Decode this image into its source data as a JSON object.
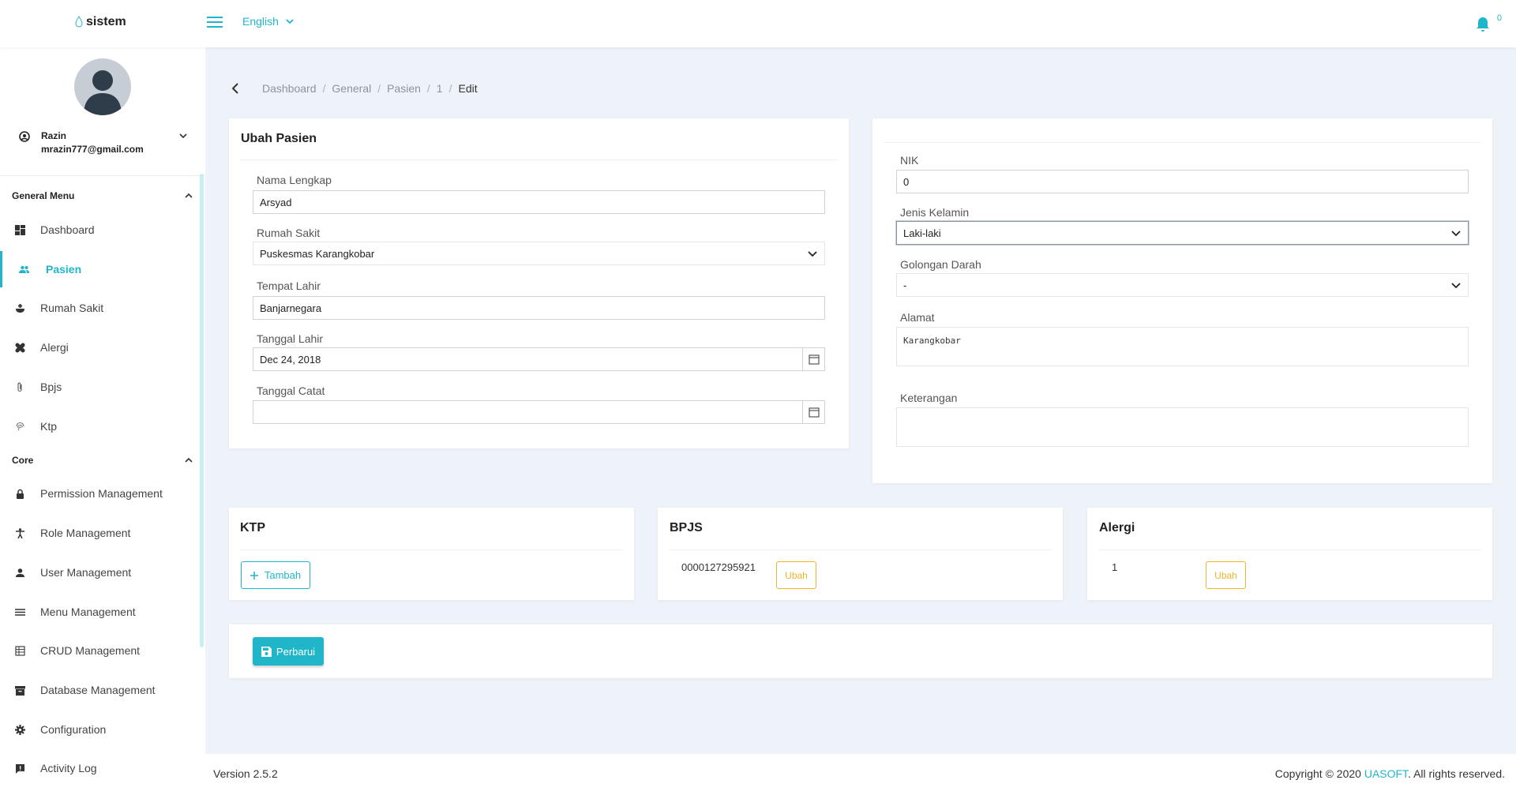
{
  "app": {
    "logo_text": "sistem",
    "language": "English",
    "notification_count": "0"
  },
  "user": {
    "name": "Razin",
    "email": "mrazin777@gmail.com"
  },
  "sidebar": {
    "general_menu": "General Menu",
    "core": "Core",
    "general_items": [
      {
        "label": "Dashboard",
        "icon": "dashboard-icon"
      },
      {
        "label": "Pasien",
        "icon": "users-icon",
        "active": true
      },
      {
        "label": "Rumah Sakit",
        "icon": "hospital-icon"
      },
      {
        "label": "Alergi",
        "icon": "bandage-icon"
      },
      {
        "label": "Bpjs",
        "icon": "paperclip-icon"
      },
      {
        "label": "Ktp",
        "icon": "fingerprint-icon"
      }
    ],
    "core_items": [
      {
        "label": "Permission Management",
        "icon": "lock-icon"
      },
      {
        "label": "Role Management",
        "icon": "person-icon"
      },
      {
        "label": "User Management",
        "icon": "user-icon"
      },
      {
        "label": "Menu Management",
        "icon": "menu-icon"
      },
      {
        "label": "CRUD Management",
        "icon": "table-icon"
      },
      {
        "label": "Database Management",
        "icon": "archive-icon"
      },
      {
        "label": "Configuration",
        "icon": "gear-icon"
      },
      {
        "label": "Activity Log",
        "icon": "feedback-icon"
      }
    ]
  },
  "breadcrumb": [
    "Dashboard",
    "General",
    "Pasien",
    "1",
    "Edit"
  ],
  "form": {
    "title": "Ubah Pasien",
    "nama_lengkap": {
      "label": "Nama Lengkap",
      "value": "Arsyad"
    },
    "rumah_sakit": {
      "label": "Rumah Sakit",
      "value": "Puskesmas Karangkobar"
    },
    "tempat_lahir": {
      "label": "Tempat Lahir",
      "value": "Banjarnegara"
    },
    "tanggal_lahir": {
      "label": "Tanggal Lahir",
      "value": "Dec 24, 2018"
    },
    "tanggal_catat": {
      "label": "Tanggal Catat",
      "value": ""
    },
    "nik": {
      "label": "NIK",
      "value": "0"
    },
    "jenis_kelamin": {
      "label": "Jenis Kelamin",
      "value": "Laki-laki"
    },
    "golongan_darah": {
      "label": "Golongan Darah",
      "value": "-"
    },
    "alamat": {
      "label": "Alamat",
      "value": "Karangkobar"
    },
    "keterangan": {
      "label": "Keterangan",
      "value": ""
    }
  },
  "ktp": {
    "title": "KTP",
    "add_label": "Tambah"
  },
  "bpjs": {
    "title": "BPJS",
    "number": "0000127295921",
    "edit_label": "Ubah"
  },
  "alergi": {
    "title": "Alergi",
    "value": "1",
    "edit_label": "Ubah"
  },
  "submit_label": "Perbarui",
  "footer": {
    "version": "Version 2.5.2",
    "copy_prefix": "Copyright © 2020 ",
    "company": "UASOFT",
    "copy_suffix": ". All rights reserved."
  },
  "colors": {
    "accent": "#20b6c9",
    "warning": "#f0b429"
  }
}
